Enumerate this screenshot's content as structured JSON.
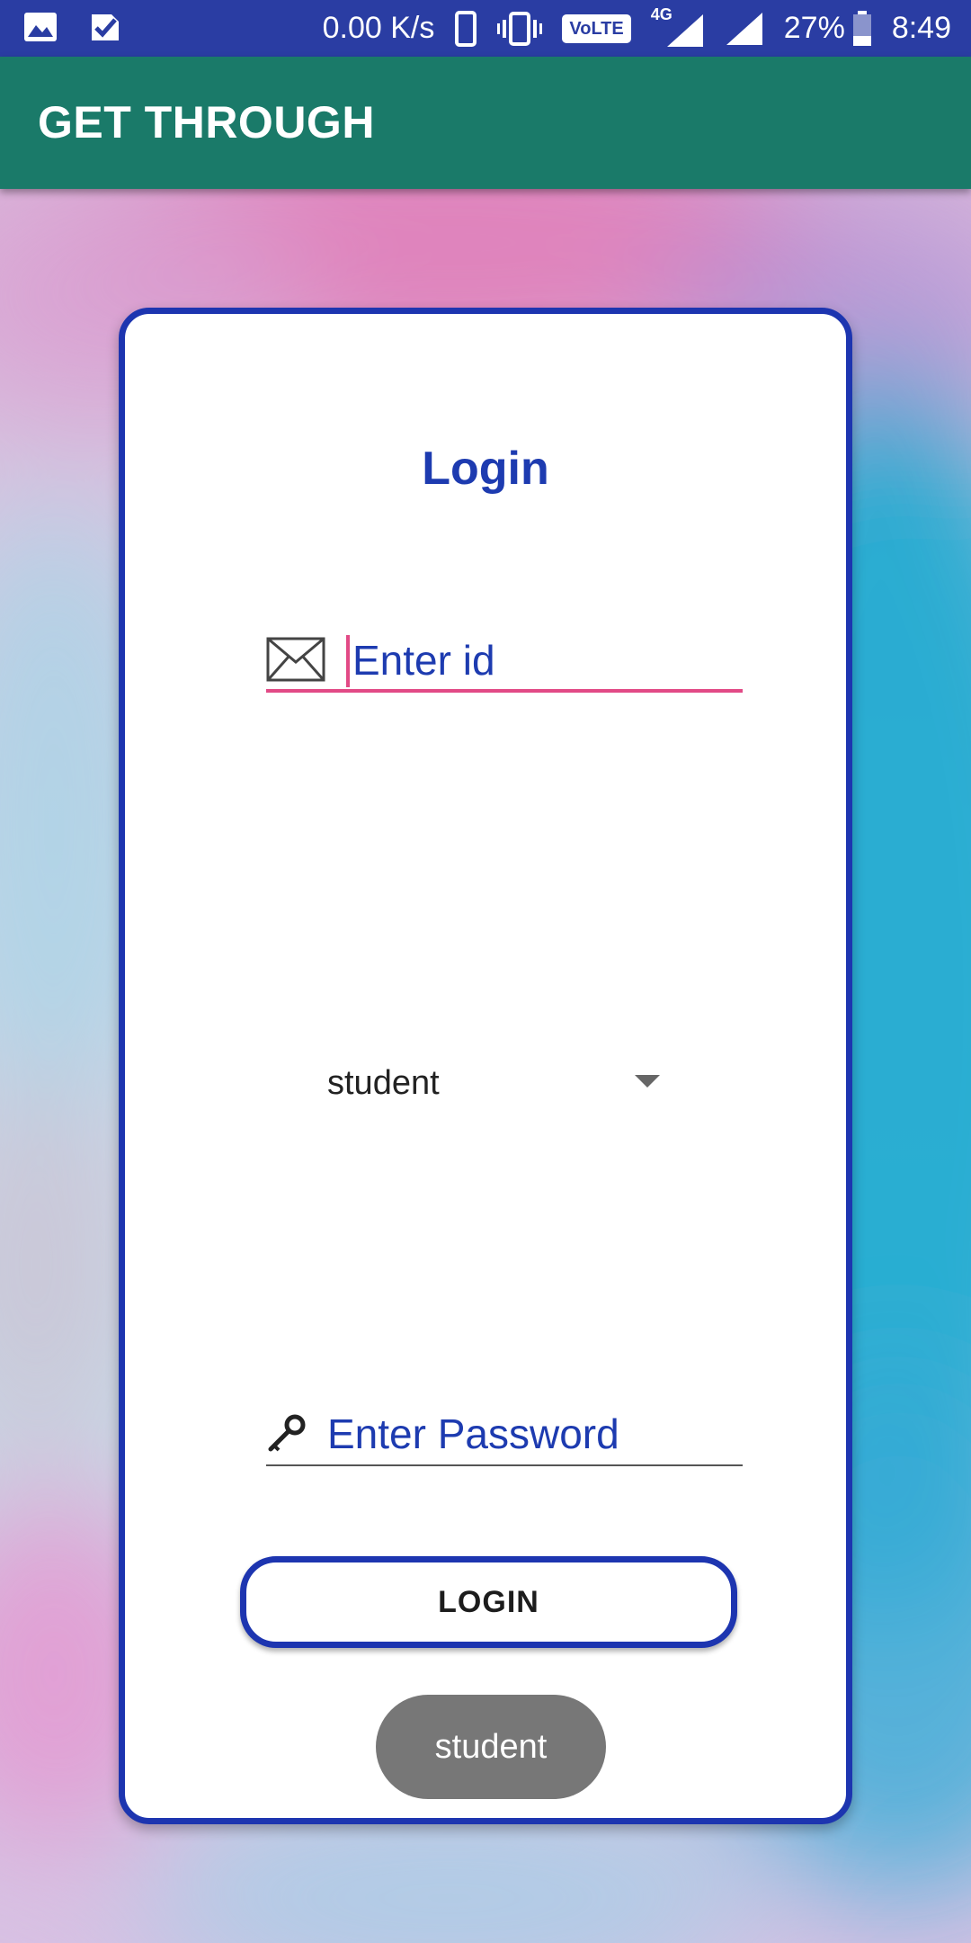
{
  "status_bar": {
    "net_speed": "0.00 K/s",
    "volte": "VoLTE",
    "network": "4G",
    "battery": "27%",
    "time": "8:49",
    "icons": [
      "gallery-icon",
      "check-icon",
      "phone-icon",
      "vibrate-icon",
      "volte-icon",
      "signal-icon",
      "signal-icon",
      "battery-icon"
    ]
  },
  "app_bar": {
    "title": "GET THROUGH"
  },
  "login_card": {
    "title": "Login",
    "id_placeholder": "Enter id",
    "role_selected": "student",
    "password_placeholder": "Enter Password",
    "login_button": "LOGIN"
  },
  "toast": {
    "text": "student"
  },
  "colors": {
    "status_bar": "#2a3da3",
    "app_bar": "#1a7a69",
    "accent_blue": "#1d35b0",
    "focus_pink": "#e24a86",
    "toast": "#777777"
  }
}
